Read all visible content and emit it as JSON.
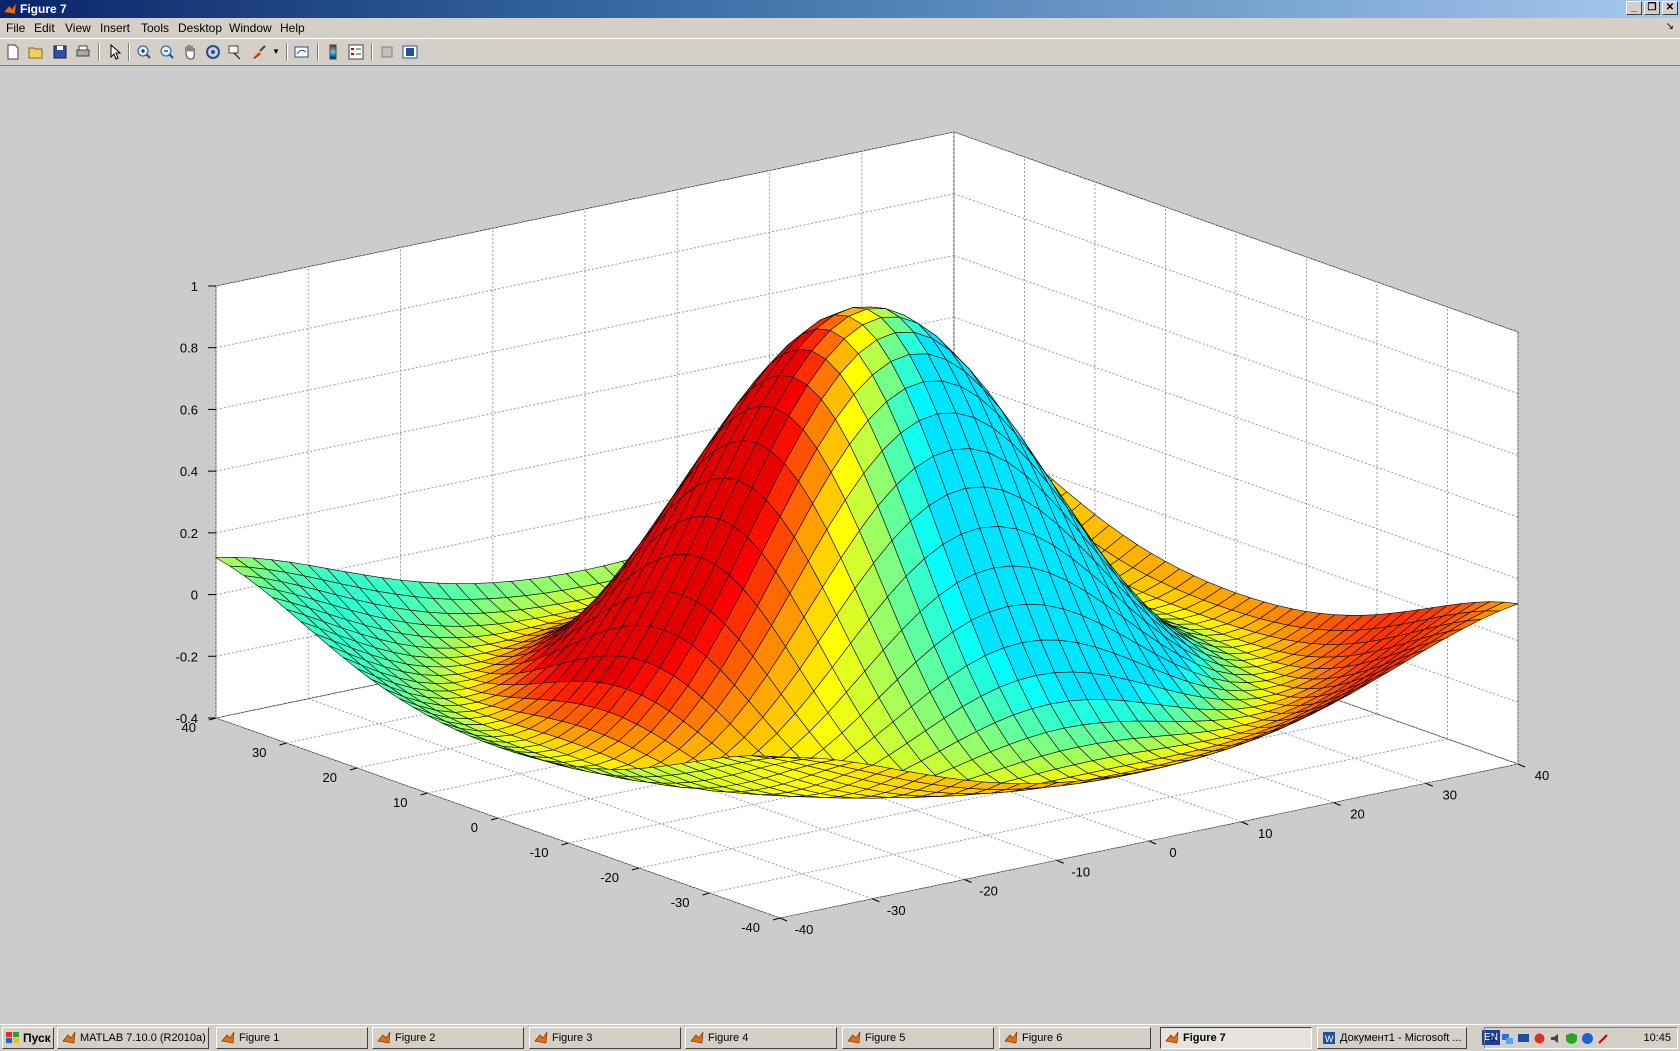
{
  "window": {
    "title": "Figure 7",
    "buttons": [
      "minimize",
      "restore",
      "close"
    ]
  },
  "menu": [
    "File",
    "Edit",
    "View",
    "Insert",
    "Tools",
    "Desktop",
    "Window",
    "Help"
  ],
  "toolbar": {
    "buttons": [
      "new-figure",
      "open-file",
      "save-figure",
      "print-figure",
      "edit-plot",
      "zoom-in",
      "zoom-out",
      "pan",
      "rotate-3d",
      "data-cursor",
      "brush",
      "link-plot",
      "colorbar",
      "legend",
      "hide-plot-tools",
      "show-plot-tools"
    ]
  },
  "chart_data": {
    "type": "surface",
    "title": "",
    "xlabel": "",
    "ylabel": "",
    "zlabel": "",
    "xlim": [
      -40,
      40
    ],
    "ylim": [
      -40,
      40
    ],
    "zlim": [
      -0.4,
      1
    ],
    "x_ticks": [
      "-40",
      "-30",
      "-20",
      "-10",
      "0",
      "10",
      "20",
      "30",
      "40"
    ],
    "y_ticks": [
      "-40",
      "-30",
      "-20",
      "-10",
      "0",
      "10",
      "20",
      "30",
      "40"
    ],
    "z_ticks": [
      "-0.4",
      "-0.2",
      "0",
      "0.2",
      "0.4",
      "0.6",
      "0.8",
      "1"
    ],
    "function": "sinc-like radial surface, peak z=1 at (0,0), ring minimum near z=-0.22, flat near 0 at edges",
    "grid": true,
    "colormap": "jet"
  },
  "taskbar": {
    "start_label": "Пуск",
    "tasks": [
      {
        "label": "MATLAB  7.10.0 (R2010a)",
        "active": false
      },
      {
        "label": "Figure 1",
        "active": false
      },
      {
        "label": "Figure 2",
        "active": false
      },
      {
        "label": "Figure 3",
        "active": false
      },
      {
        "label": "Figure 4",
        "active": false
      },
      {
        "label": "Figure 5",
        "active": false
      },
      {
        "label": "Figure 6",
        "active": false
      },
      {
        "label": "Figure 7",
        "active": true
      },
      {
        "label": "Документ1 - Microsoft ...",
        "active": false
      }
    ],
    "language": "EN",
    "tray_arrow": "«",
    "clock": "10:45"
  }
}
